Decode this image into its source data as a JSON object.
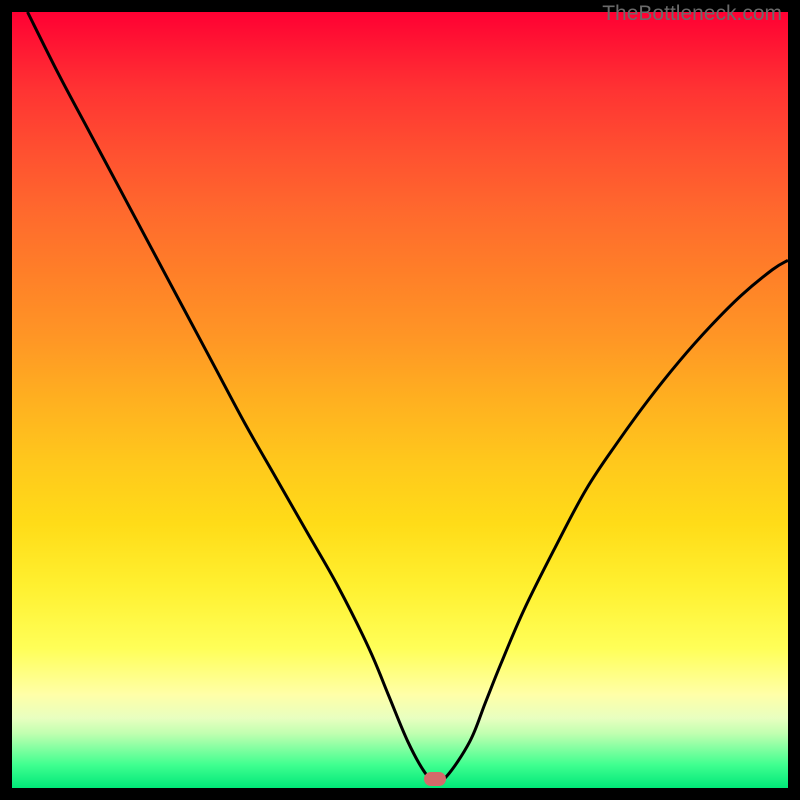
{
  "attribution": "TheBottleneck.com",
  "chart_data": {
    "type": "line",
    "title": "",
    "xlabel": "",
    "ylabel": "",
    "xlim": [
      0,
      100
    ],
    "ylim": [
      0,
      100
    ],
    "series": [
      {
        "name": "curve",
        "x": [
          2,
          6,
          10,
          14,
          18,
          22,
          26,
          30,
          34,
          38,
          42,
          46,
          48.5,
          51,
          53.2,
          54.5,
          56,
          59,
          61,
          63,
          66,
          70,
          74,
          78,
          82,
          86,
          90,
          94,
          98,
          100
        ],
        "y": [
          100,
          92,
          84.5,
          77,
          69.5,
          62,
          54.5,
          47,
          40,
          33,
          26,
          18,
          12,
          6,
          2,
          1,
          1.5,
          6,
          11,
          16,
          23,
          31,
          38.5,
          44.5,
          50,
          55,
          59.5,
          63.5,
          66.8,
          68
        ]
      }
    ],
    "marker": {
      "x": 54.5,
      "y": 1.2,
      "color": "#d46a6a"
    },
    "gradient_stops": [
      {
        "pos": 0,
        "color": "#ff0033"
      },
      {
        "pos": 50,
        "color": "#ffb020"
      },
      {
        "pos": 82,
        "color": "#ffff58"
      },
      {
        "pos": 100,
        "color": "#00e878"
      }
    ]
  }
}
